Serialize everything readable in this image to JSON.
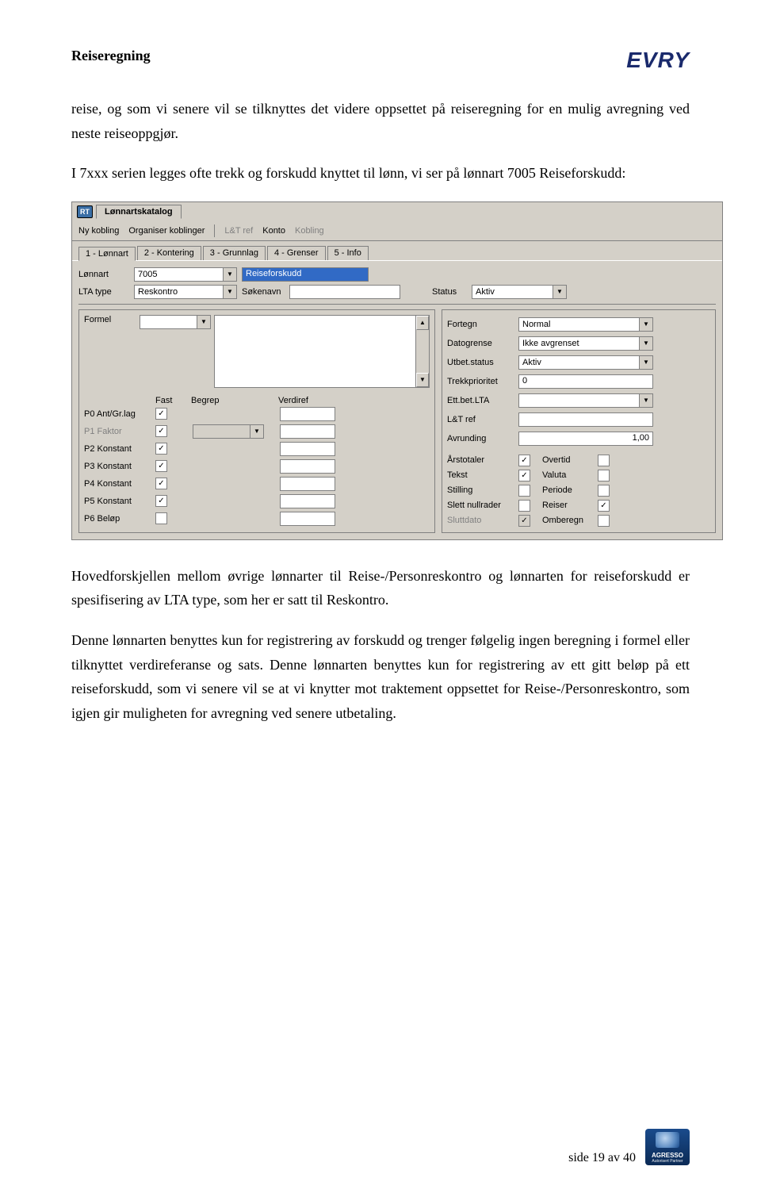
{
  "header": {
    "title": "Reiseregning",
    "logo": "EVRY"
  },
  "paragraphs": {
    "p1": "reise, og som vi senere vil se tilknyttes det videre oppsettet på reiseregning for en mulig avregning  ved neste reiseoppgjør.",
    "p2": "I 7xxx serien legges ofte trekk og forskudd knyttet til lønn, vi ser på lønnart 7005 Reiseforskudd:",
    "p3": "Hovedforskjellen mellom øvrige lønnarter til Reise-/Personreskontro og lønnarten for reiseforskudd er spesifisering av LTA type, som her er satt til Reskontro.",
    "p4": "Denne lønnarten benyttes kun for registrering av forskudd og trenger følgelig ingen beregning i formel eller tilknyttet verdireferanse og sats. Denne lønnarten benyttes kun for registrering av ett gitt beløp på ett reiseforskudd, som vi senere vil se at vi knytter mot traktement oppsettet for Reise-/Personreskontro, som igjen gir muligheten for avregning ved senere utbetaling."
  },
  "app": {
    "window_title": "Lønnartskatalog",
    "rt_badge": "RT",
    "toolbar": {
      "ny_kobling": "Ny kobling",
      "organiser": "Organiser koblinger",
      "lat_ref": "L&T ref",
      "konto": "Konto",
      "kobling": "Kobling"
    },
    "tabs": {
      "t1": "1 - Lønnart",
      "t2": "2 - Kontering",
      "t3": "3 - Grunnlag",
      "t4": "4 - Grenser",
      "t5": "5 - Info"
    },
    "fields": {
      "lonnart_lbl": "Lønnart",
      "lonnart_val": "7005",
      "lonnart_name": "Reiseforskudd",
      "lta_lbl": "LTA type",
      "lta_val": "Reskontro",
      "sokenavn_lbl": "Søkenavn",
      "sokenavn_val": "",
      "status_lbl": "Status",
      "status_val": "Aktiv"
    },
    "left": {
      "formel_lbl": "Formel",
      "head_fast": "Fast",
      "head_begrep": "Begrep",
      "head_verdiref": "Verdiref",
      "rows": [
        {
          "label": "P0 Ant/Gr.lag",
          "fast": true
        },
        {
          "label": "P1 Faktor",
          "fast": true,
          "disabled": true,
          "has_combo": true
        },
        {
          "label": "P2 Konstant",
          "fast": true
        },
        {
          "label": "P3 Konstant",
          "fast": true
        },
        {
          "label": "P4 Konstant",
          "fast": true
        },
        {
          "label": "P5 Konstant",
          "fast": true
        },
        {
          "label": "P6 Beløp",
          "fast": false
        }
      ]
    },
    "right": {
      "rows": [
        {
          "label": "Fortegn",
          "value": "Normal",
          "type": "combo"
        },
        {
          "label": "Datogrense",
          "value": "Ikke avgrenset",
          "type": "combo"
        },
        {
          "label": "Utbet.status",
          "value": "Aktiv",
          "type": "combo"
        },
        {
          "label": "Trekkprioritet",
          "value": "0",
          "type": "text"
        },
        {
          "label": "Ett.bet.LTA",
          "value": "",
          "type": "combo"
        },
        {
          "label": "L&T ref",
          "value": "",
          "type": "text"
        },
        {
          "label": "Avrunding",
          "value": "1,00",
          "type": "text-right"
        }
      ],
      "checks": [
        {
          "l1": "Årstotaler",
          "c1": true,
          "l2": "Overtid",
          "c2": false
        },
        {
          "l1": "Tekst",
          "c1": true,
          "l2": "Valuta",
          "c2": false
        },
        {
          "l1": "Stilling",
          "c1": false,
          "l2": "Periode",
          "c2": false
        },
        {
          "l1": "Slett nullrader",
          "c1": false,
          "l2": "Reiser",
          "c2": true
        },
        {
          "l1": "Sluttdato",
          "c1": true,
          "l2": "Omberegn",
          "c2": false,
          "disabled1": true
        }
      ]
    }
  },
  "footer": {
    "page": "side 19 av 40",
    "agresso1": "AGRESSO",
    "agresso2": "Autorisert Partner"
  }
}
